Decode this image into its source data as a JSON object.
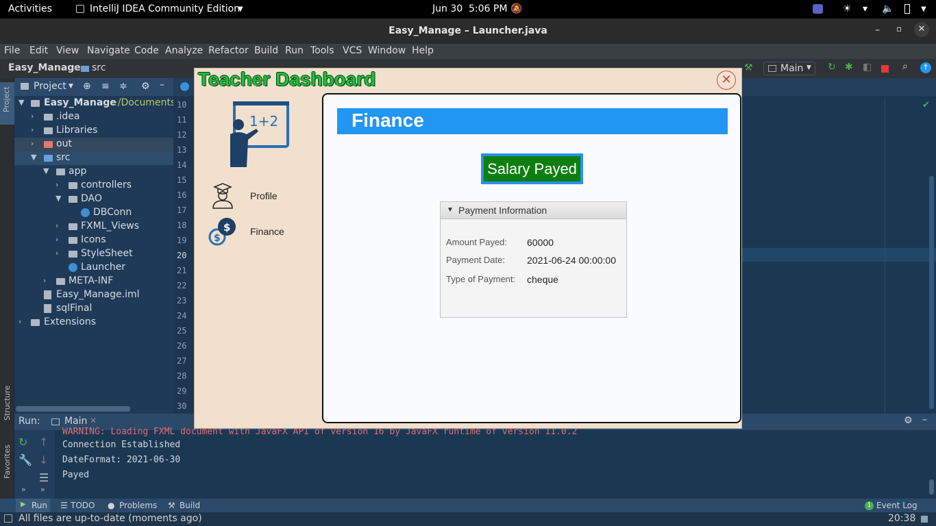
{
  "topbar": {
    "activities": "Activities",
    "app_name": "IntelliJ IDEA Community Edition",
    "date": "Jun 30",
    "time": "5:06 PM"
  },
  "ide": {
    "window_title": "Easy_Manage – Launcher.java",
    "menu": [
      "File",
      "Edit",
      "View",
      "Navigate",
      "Code",
      "Analyze",
      "Refactor",
      "Build",
      "Run",
      "Tools",
      "VCS",
      "Window",
      "Help"
    ],
    "breadcrumb": {
      "project": "Easy_Manage",
      "folder": "src"
    },
    "run_config": "Main",
    "project_panel": {
      "title": "Project",
      "root_name": "Easy_Manage",
      "root_path": "~/Documents/",
      "nodes": [
        {
          "label": ".idea"
        },
        {
          "label": "Libraries"
        },
        {
          "label": "out"
        },
        {
          "label": "src"
        },
        {
          "label": "app"
        },
        {
          "label": "controllers"
        },
        {
          "label": "DAO"
        },
        {
          "label": "DBConn"
        },
        {
          "label": "FXML_Views"
        },
        {
          "label": "Icons"
        },
        {
          "label": "StyleSheet"
        },
        {
          "label": "Launcher"
        },
        {
          "label": "META-INF"
        },
        {
          "label": "Easy_Manage.iml"
        },
        {
          "label": "sqlFinal"
        },
        {
          "label": "Extensions"
        }
      ]
    },
    "line_numbers": [
      "10",
      "11",
      "12",
      "13",
      "14",
      "15",
      "16",
      "17",
      "18",
      "19",
      "20",
      "21",
      "22",
      "23",
      "24",
      "25",
      "26",
      "27",
      "28",
      "29",
      "30"
    ],
    "left_stripe": {
      "project": "Project",
      "structure": "Structure",
      "favorites": "Favorites"
    },
    "run_panel": {
      "label": "Run:",
      "tab": "Main",
      "console_lines": [
        "WARNING: Loading FXML document with JavaFX API of version 16 by JavaFX runtime of version 11.0.2",
        "Connection Established",
        "DateFormat: 2021-06-30",
        "Payed"
      ]
    },
    "bottom_tabs": {
      "run": "Run",
      "todo": "TODO",
      "problems": "Problems",
      "build": "Build",
      "event_log": "Event Log",
      "event_count": "1"
    },
    "status": {
      "message": "All files are up-to-date (moments ago)",
      "position": "20:38"
    }
  },
  "app": {
    "title": "Teacher Dashboard",
    "nav": {
      "profile": "Profile",
      "finance": "Finance"
    },
    "section_title": "Finance",
    "salary_status": "Salary Payed",
    "payment": {
      "header": "Payment Information",
      "rows": [
        {
          "key": "Amount Payed:",
          "value": "60000"
        },
        {
          "key": "Payment Date:",
          "value": "2021-06-24 00:00:00"
        },
        {
          "key": "Type of Payment:",
          "value": "cheque"
        }
      ]
    }
  },
  "colors": {
    "accent_blue": "#2196f3",
    "salary_green": "#0d7f10",
    "title_green": "#1fbf3c",
    "ide_background": "#1f3a57"
  }
}
